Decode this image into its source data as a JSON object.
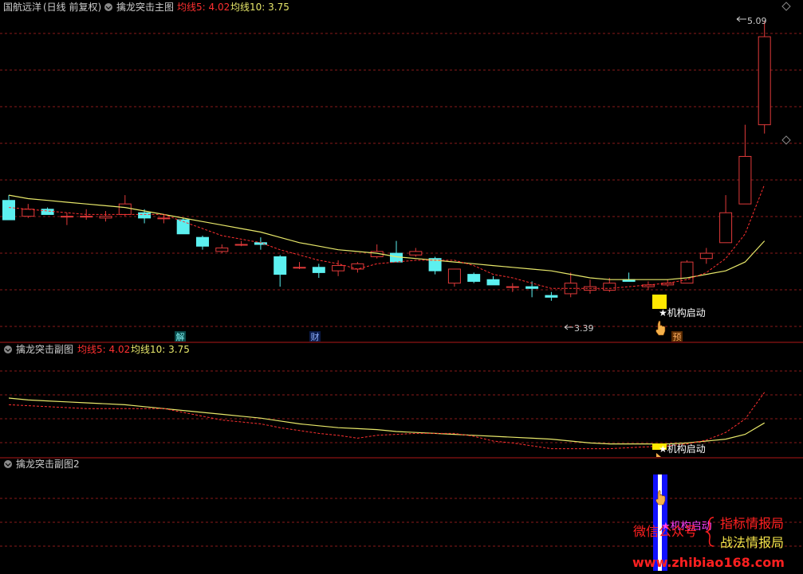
{
  "colors": {
    "background": "#000000",
    "grid": "#8a1a1a",
    "border": "#b01818",
    "up": "#e03a3a",
    "down": "#5cf0f0",
    "ma5": "#ff3030",
    "ma10": "#e8e86a",
    "text": "#cccccc",
    "yellow": "#ffe800",
    "blue": "#1010ff",
    "magenta": "#ff40ff",
    "watermark_red": "#ff2020",
    "watermark_yellow": "#f5e44a"
  },
  "main_panel": {
    "stock_name": "国航远洋",
    "period": "(日线 前复权)",
    "indicator_name": "擒龙突击主图",
    "ma5_label": "均线5: 4.02",
    "ma10_label": "均线10: 3.75",
    "high_label": "5.09",
    "low_label": "3.39",
    "signal_label": "★机构启动",
    "markers": [
      "解",
      "财",
      "预"
    ]
  },
  "sub_panel1": {
    "indicator_name": "擒龙突击副图",
    "ma5_label": "均线5: 4.02",
    "ma10_label": "均线10: 3.75",
    "signal_label": "★机构启动"
  },
  "sub_panel2": {
    "indicator_name": "擒龙突击副图2",
    "signal_label": "★机构启动"
  },
  "watermark": {
    "wechat": "微信公众号",
    "line1": "指标情报局",
    "line2": "战法情报局",
    "url": "www.zhibiao168.com"
  },
  "chart_data": {
    "type": "candlestick",
    "price_range": [
      3.3,
      5.1
    ],
    "candles": [
      {
        "o": 4.07,
        "h": 4.1,
        "l": 3.96,
        "c": 3.96
      },
      {
        "o": 3.98,
        "h": 4.05,
        "l": 3.97,
        "c": 4.02
      },
      {
        "o": 4.02,
        "h": 4.03,
        "l": 3.99,
        "c": 3.99
      },
      {
        "o": 3.98,
        "h": 4.0,
        "l": 3.93,
        "c": 3.98
      },
      {
        "o": 3.98,
        "h": 4.02,
        "l": 3.96,
        "c": 3.98
      },
      {
        "o": 3.97,
        "h": 4.01,
        "l": 3.95,
        "c": 3.98
      },
      {
        "o": 3.99,
        "h": 4.1,
        "l": 3.98,
        "c": 4.05
      },
      {
        "o": 4.0,
        "h": 4.02,
        "l": 3.94,
        "c": 3.97
      },
      {
        "o": 3.97,
        "h": 3.99,
        "l": 3.94,
        "c": 3.97
      },
      {
        "o": 3.96,
        "h": 3.97,
        "l": 3.88,
        "c": 3.88
      },
      {
        "o": 3.86,
        "h": 3.87,
        "l": 3.79,
        "c": 3.81
      },
      {
        "o": 3.78,
        "h": 3.82,
        "l": 3.77,
        "c": 3.8
      },
      {
        "o": 3.82,
        "h": 3.84,
        "l": 3.81,
        "c": 3.82
      },
      {
        "o": 3.83,
        "h": 3.86,
        "l": 3.79,
        "c": 3.82
      },
      {
        "o": 3.75,
        "h": 3.76,
        "l": 3.58,
        "c": 3.65
      },
      {
        "o": 3.69,
        "h": 3.72,
        "l": 3.68,
        "c": 3.69
      },
      {
        "o": 3.69,
        "h": 3.71,
        "l": 3.63,
        "c": 3.66
      },
      {
        "o": 3.67,
        "h": 3.73,
        "l": 3.64,
        "c": 3.7
      },
      {
        "o": 3.68,
        "h": 3.72,
        "l": 3.66,
        "c": 3.71
      },
      {
        "o": 3.75,
        "h": 3.82,
        "l": 3.74,
        "c": 3.78
      },
      {
        "o": 3.77,
        "h": 3.84,
        "l": 3.74,
        "c": 3.72
      },
      {
        "o": 3.76,
        "h": 3.8,
        "l": 3.75,
        "c": 3.78
      },
      {
        "o": 3.74,
        "h": 3.75,
        "l": 3.65,
        "c": 3.67
      },
      {
        "o": 3.6,
        "h": 3.68,
        "l": 3.58,
        "c": 3.68
      },
      {
        "o": 3.65,
        "h": 3.66,
        "l": 3.6,
        "c": 3.61
      },
      {
        "o": 3.62,
        "h": 3.64,
        "l": 3.59,
        "c": 3.59
      },
      {
        "o": 3.58,
        "h": 3.6,
        "l": 3.55,
        "c": 3.58
      },
      {
        "o": 3.58,
        "h": 3.61,
        "l": 3.52,
        "c": 3.57
      },
      {
        "o": 3.53,
        "h": 3.55,
        "l": 3.5,
        "c": 3.52
      },
      {
        "o": 3.54,
        "h": 3.66,
        "l": 3.52,
        "c": 3.6
      },
      {
        "o": 3.56,
        "h": 3.62,
        "l": 3.54,
        "c": 3.58
      },
      {
        "o": 3.56,
        "h": 3.63,
        "l": 3.55,
        "c": 3.6
      },
      {
        "o": 3.62,
        "h": 3.66,
        "l": 3.61,
        "c": 3.61
      },
      {
        "o": 3.58,
        "h": 3.61,
        "l": 3.56,
        "c": 3.59
      },
      {
        "o": 3.59,
        "h": 3.62,
        "l": 3.58,
        "c": 3.6
      },
      {
        "o": 3.6,
        "h": 3.73,
        "l": 3.6,
        "c": 3.72
      },
      {
        "o": 3.74,
        "h": 3.8,
        "l": 3.71,
        "c": 3.77
      },
      {
        "o": 3.83,
        "h": 4.1,
        "l": 3.83,
        "c": 4.0
      },
      {
        "o": 4.05,
        "h": 4.5,
        "l": 4.05,
        "c": 4.32
      },
      {
        "o": 4.5,
        "h": 5.09,
        "l": 4.45,
        "c": 5.0
      }
    ],
    "ma5": [
      4.03,
      4.02,
      4.01,
      4.0,
      3.99,
      3.99,
      3.99,
      3.99,
      3.99,
      3.95,
      3.91,
      3.87,
      3.85,
      3.83,
      3.79,
      3.76,
      3.73,
      3.71,
      3.68,
      3.71,
      3.72,
      3.73,
      3.73,
      3.73,
      3.7,
      3.65,
      3.63,
      3.6,
      3.57,
      3.57,
      3.57,
      3.57,
      3.58,
      3.59,
      3.6,
      3.62,
      3.66,
      3.74,
      3.88,
      4.16
    ],
    "ma10": [
      4.1,
      4.08,
      4.07,
      4.06,
      4.05,
      4.04,
      4.03,
      4.01,
      3.99,
      3.97,
      3.95,
      3.93,
      3.91,
      3.89,
      3.86,
      3.83,
      3.81,
      3.79,
      3.78,
      3.77,
      3.75,
      3.74,
      3.73,
      3.72,
      3.71,
      3.7,
      3.69,
      3.68,
      3.67,
      3.65,
      3.63,
      3.62,
      3.62,
      3.62,
      3.62,
      3.63,
      3.65,
      3.67,
      3.72,
      3.84
    ]
  }
}
